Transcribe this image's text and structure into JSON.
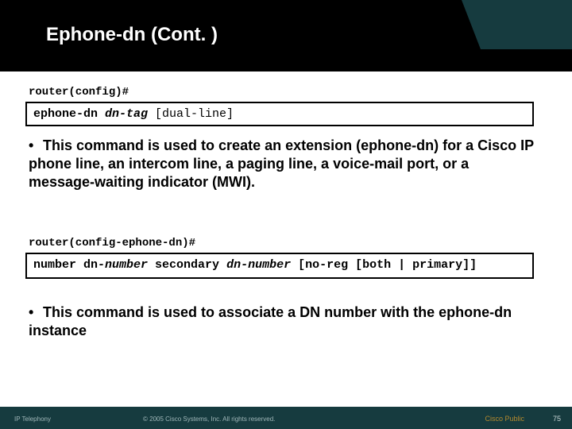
{
  "title": "Ephone-dn (Cont. )",
  "prompt1": "router(config)#",
  "cmd1": {
    "a": "ephone-dn ",
    "b": "dn-tag",
    "c": " [dual-line]"
  },
  "bullet1": "This command is used to create an extension (ephone-dn) for a Cisco IP phone line, an intercom line, a paging line, a voice-mail port, or a message-waiting indicator (MWI).",
  "prompt2": "router(config-ephone-dn)#",
  "cmd2": {
    "a": "number dn",
    "b": "-number",
    "c": " secondary ",
    "d": "dn-number",
    "e": " [no-reg [both | primary]]"
  },
  "bullet2": "This command is used to associate a DN number with the ephone-dn instance",
  "footer": {
    "left": "IP Telephony",
    "center": "© 2005 Cisco Systems, Inc. All rights reserved.",
    "right": "Cisco Public",
    "page": "75"
  }
}
